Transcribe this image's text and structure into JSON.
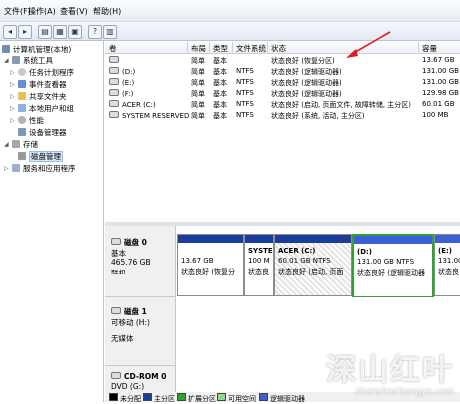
{
  "menu": [
    "文件(F)",
    "操作(A)",
    "查看(V)",
    "帮助(H)"
  ],
  "tree": {
    "root": "计算机管理(本地)",
    "system_tools": "系统工具",
    "task_scheduler": "任务计划程序",
    "event_viewer": "事件查看器",
    "shared_folders": "共享文件夹",
    "local_users": "本地用户和组",
    "performance": "性能",
    "device_manager": "设备管理器",
    "storage": "存储",
    "disk_management": "磁盘管理",
    "services_apps": "服务和应用程序"
  },
  "volumes": {
    "headers": [
      "卷",
      "布局",
      "类型",
      "文件系统",
      "状态",
      "容量"
    ],
    "rows": [
      [
        "",
        "简单",
        "基本",
        "",
        "状态良好 (恢复分区)",
        "13.67 GB"
      ],
      [
        "(D:)",
        "简单",
        "基本",
        "NTFS",
        "状态良好 (逻辑驱动器)",
        "131.00 GB"
      ],
      [
        "(E:)",
        "简单",
        "基本",
        "NTFS",
        "状态良好 (逻辑驱动器)",
        "131.00 GB"
      ],
      [
        "(F:)",
        "简单",
        "基本",
        "NTFS",
        "状态良好 (逻辑驱动器)",
        "129.98 GB"
      ],
      [
        "ACER (C:)",
        "简单",
        "基本",
        "NTFS",
        "状态良好 (启动, 页面文件, 故障转储, 主分区)",
        "60.01 GB"
      ],
      [
        "SYSTEM RESERVED",
        "简单",
        "基本",
        "NTFS",
        "状态良好 (系统, 活动, 主分区)",
        "100 MB"
      ]
    ]
  },
  "disk0": {
    "name": "磁盘 0",
    "type": "基本",
    "size": "465.76 GB",
    "status": "联机",
    "partitions": [
      {
        "title": "",
        "line1": "13.67 GB",
        "line2": "状态良好 (恢复分"
      },
      {
        "title": "SYSTE",
        "line1": "100 M",
        "line2": "状态良"
      },
      {
        "title": "ACER (C:)",
        "line1": "60.01 GB NTFS",
        "line2": "状态良好 (启动, 页面"
      },
      {
        "title": "(D:)",
        "line1": "131.00 GB NTFS",
        "line2": "状态良好 (逻辑驱动器"
      },
      {
        "title": "(E:)",
        "line1": "131.00",
        "line2": "状态良"
      }
    ]
  },
  "disk1": {
    "name": "磁盘 1",
    "type": "可移动 (H:)",
    "status": "无媒体"
  },
  "cdrom": {
    "name": "CD-ROM 0",
    "type": "DVD (G:)"
  },
  "legend": [
    {
      "label": "未分配",
      "color": "#000000"
    },
    {
      "label": "主分区",
      "color": "#1a3d9c"
    },
    {
      "label": "扩展分区",
      "color": "#2fa32f"
    },
    {
      "label": "可用空间",
      "color": "#8fd88f"
    },
    {
      "label": "逻辑驱动器",
      "color": "#3b5fd9"
    }
  ],
  "watermark": {
    "big": "深山红叶",
    "small": "shenshanhongye.com"
  }
}
